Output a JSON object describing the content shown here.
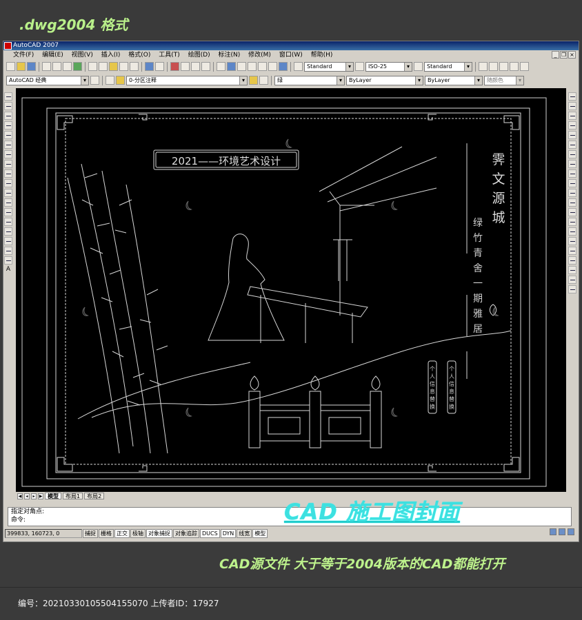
{
  "promo": {
    "format_label": ".dwg2004 格式",
    "headline": "CAD 施工图封面",
    "tagline": "CAD源文件  大于等于2004版本的CAD都能打开"
  },
  "window": {
    "title": "AutoCAD 2007",
    "mdi_buttons": [
      "_",
      "❐",
      "×"
    ]
  },
  "menu": {
    "items": [
      "文件(F)",
      "编辑(E)",
      "视图(V)",
      "插入(I)",
      "格式(O)",
      "工具(T)",
      "绘图(D)",
      "标注(N)",
      "修改(M)",
      "窗口(W)",
      "帮助(H)"
    ]
  },
  "toolbar": {
    "text_style": "Standard",
    "dim_style": "ISO-25",
    "table_style": "Standard",
    "workspace": "AutoCAD 经典",
    "layer": "0-分区注释",
    "color": "绿",
    "linetype": "ByLayer",
    "lineweight": "ByLayer",
    "plotstyle": "随颜色"
  },
  "drawing": {
    "title_box": "2021——环境艺术设计",
    "brand_chars": [
      "霁",
      "文",
      "源",
      "城"
    ],
    "subtitle_chars": [
      "绿",
      "竹",
      "青",
      "舍",
      "一",
      "期",
      "雅",
      "居"
    ],
    "seal_left": [
      "个",
      "人",
      "信",
      "息",
      "替",
      "换"
    ],
    "seal_right": [
      "个",
      "人",
      "信",
      "息",
      "替",
      "换"
    ]
  },
  "tabs": {
    "items": [
      "模型",
      "布局1",
      "布局2"
    ],
    "active": "模型"
  },
  "command": {
    "line1": "指定对角点:",
    "line2": "命令:"
  },
  "status": {
    "coords": "399833, 160723, 0",
    "toggles": [
      "捕捉",
      "栅格",
      "正交",
      "极轴",
      "对象捕捉",
      "对象追踪",
      "DUCS",
      "DYN",
      "线宽",
      "模型"
    ]
  },
  "footer": {
    "text": "编号：20210330105504155070 上传者ID：17927"
  }
}
